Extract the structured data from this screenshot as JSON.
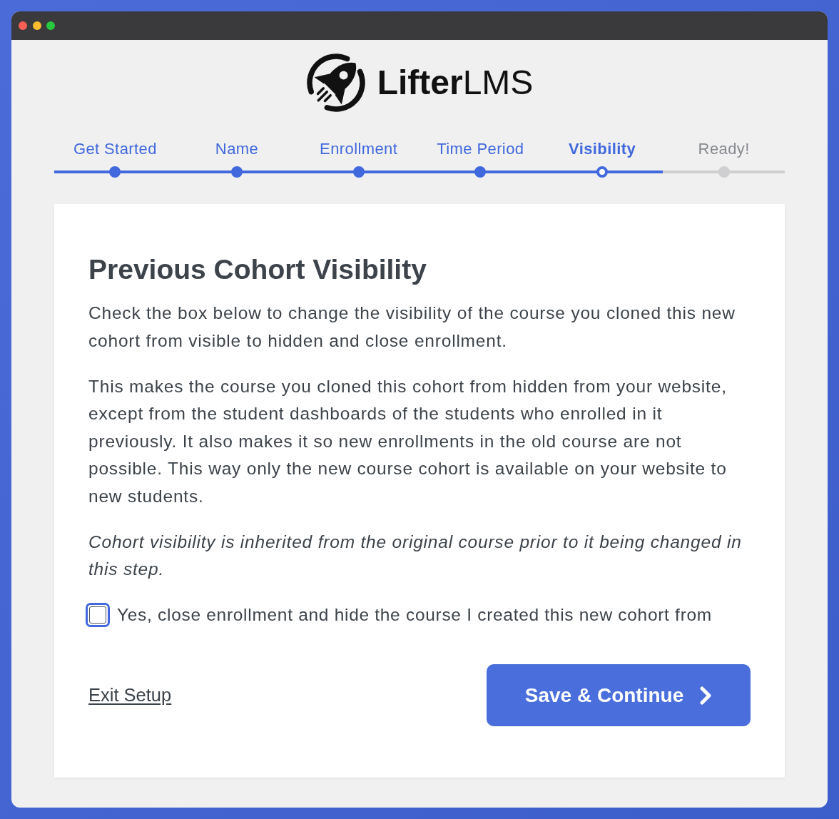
{
  "logo": {
    "text": "**Lifter**LMS"
  },
  "steps": [
    {
      "label": "Get Started",
      "selected": false,
      "done": true
    },
    {
      "label": "Name",
      "selected": false,
      "done": true
    },
    {
      "label": "Enrollment",
      "selected": false,
      "done": true
    },
    {
      "label": "Time Period",
      "selected": false,
      "done": true
    },
    {
      "label": "Visibility",
      "selected": true,
      "done": false
    },
    {
      "label": "Ready!",
      "selected": false,
      "done": false
    }
  ],
  "card": {
    "title": "Previous Cohort Visibility",
    "paragraphs": [
      {
        "kind": "plain",
        "text": "Check the box below to change the visibility of the course you cloned this new cohort from visible to hidden and close enrollment."
      },
      {
        "kind": "plain",
        "text": "This makes the course you cloned this cohort from hidden from your website, except from the student dashboards of the students who enrolled in it previously. It also makes it so new enrollments in the old course are not possible. This way only the new course cohort is available on your website to new students."
      },
      {
        "kind": "note",
        "text": "Cohort visibility is inherited from the original course prior to it being changed in this step."
      }
    ],
    "checkbox": {
      "label": "Yes, close enrollment and hide the course I created this new cohort from",
      "checked": false,
      "focused": true
    },
    "exit_link": "Exit Setup",
    "submit_button": "Save & Continue"
  }
}
